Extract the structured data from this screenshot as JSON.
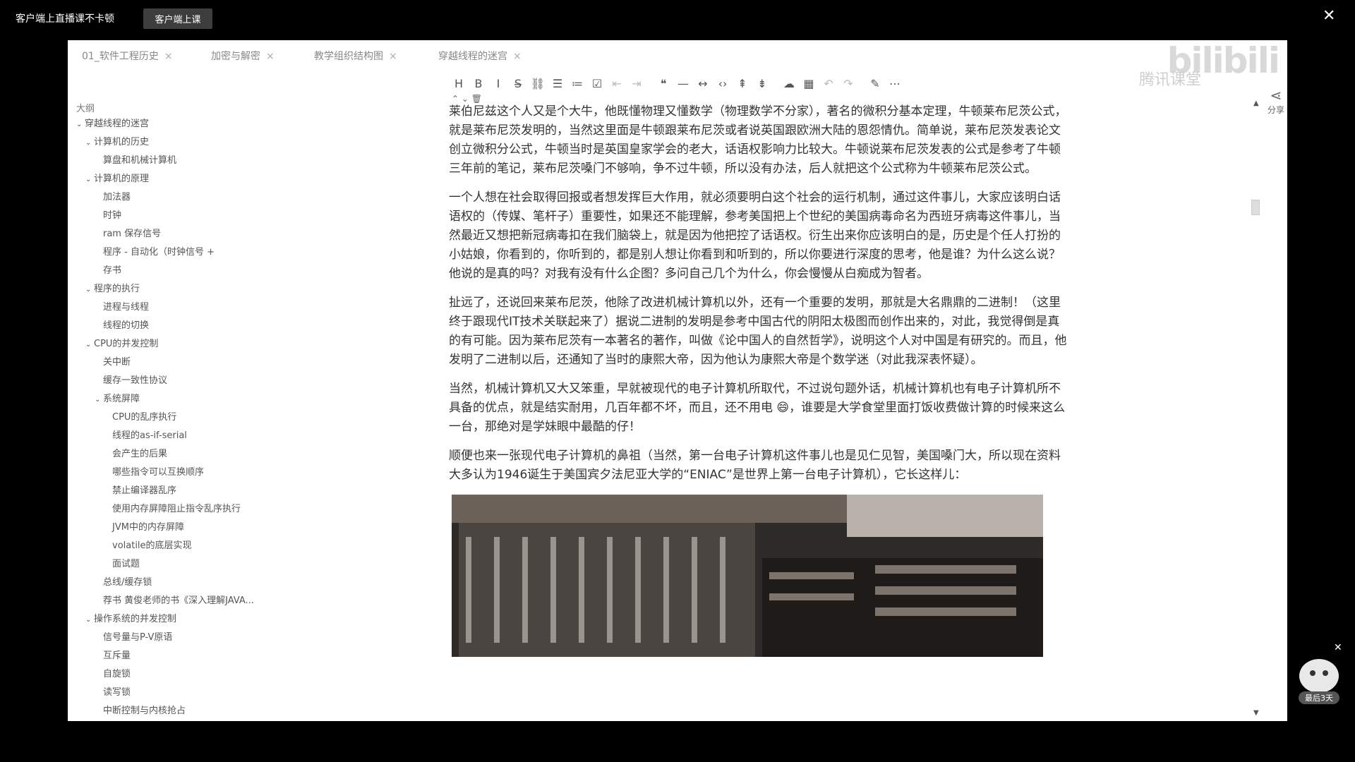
{
  "topbar": {
    "promo_text": "客户端上直播课不卡顿",
    "promo_button": "客户端上课",
    "close_label": "✕"
  },
  "tabs": [
    {
      "label": "01_软件工程历史"
    },
    {
      "label": "加密与解密"
    },
    {
      "label": "教学组织结构图"
    },
    {
      "label": "穿越线程的迷宫"
    }
  ],
  "watermark": {
    "site_logo": "bilibili",
    "tencent": "腾讯课堂"
  },
  "sidebar": {
    "title": "大纲",
    "items": [
      {
        "label": "穿越线程的迷宫",
        "level": 0,
        "expanded": true
      },
      {
        "label": "计算机的历史",
        "level": 1,
        "expanded": true
      },
      {
        "label": "算盘和机械计算机",
        "level": 2
      },
      {
        "label": "计算机的原理",
        "level": 1,
        "expanded": true
      },
      {
        "label": "加法器",
        "level": 2
      },
      {
        "label": "时钟",
        "level": 2
      },
      {
        "label": "ram 保存信号",
        "level": 2
      },
      {
        "label": "程序 - 自动化（时钟信号 +",
        "level": 2
      },
      {
        "label": "存书",
        "level": 2
      },
      {
        "label": "程序的执行",
        "level": 1,
        "expanded": true
      },
      {
        "label": "进程与线程",
        "level": 2
      },
      {
        "label": "线程的切换",
        "level": 2
      },
      {
        "label": "CPU的并发控制",
        "level": 1,
        "expanded": true
      },
      {
        "label": "关中断",
        "level": 2
      },
      {
        "label": "缓存一致性协议",
        "level": 2
      },
      {
        "label": "系统屏障",
        "level": 2,
        "expanded": true
      },
      {
        "label": "CPU的乱序执行",
        "level": 3
      },
      {
        "label": "线程的as-if-serial",
        "level": 3
      },
      {
        "label": "会产生的后果",
        "level": 3
      },
      {
        "label": "哪些指令可以互换顺序",
        "level": 3
      },
      {
        "label": "禁止编译器乱序",
        "level": 3
      },
      {
        "label": "使用内存屏障阻止指令乱序执行",
        "level": 3
      },
      {
        "label": "JVM中的内存屏障",
        "level": 3
      },
      {
        "label": "volatile的底层实现",
        "level": 3
      },
      {
        "label": "面试题",
        "level": 3
      },
      {
        "label": "总线/缓存锁",
        "level": 2
      },
      {
        "label": "荐书 黄俊老师的书《深入理解JAVA...",
        "level": 2
      },
      {
        "label": "操作系统的并发控制",
        "level": 1,
        "expanded": true
      },
      {
        "label": "信号量与P-V原语",
        "level": 2
      },
      {
        "label": "互斥量",
        "level": 2
      },
      {
        "label": "自旋锁",
        "level": 2
      },
      {
        "label": "读写锁",
        "level": 2
      },
      {
        "label": "中断控制与内核抢占",
        "level": 2
      }
    ]
  },
  "toolbar": {
    "items": [
      {
        "icon": "heading-icon",
        "glyph": "H"
      },
      {
        "icon": "bold-icon",
        "glyph": "B"
      },
      {
        "icon": "italic-icon",
        "glyph": "I"
      },
      {
        "icon": "strikethrough-icon",
        "glyph": "S̶"
      },
      {
        "icon": "link-icon",
        "glyph": "⛓"
      },
      {
        "icon": "bullet-list-icon",
        "glyph": "☰"
      },
      {
        "icon": "ordered-list-icon",
        "glyph": "≔"
      },
      {
        "icon": "checklist-icon",
        "glyph": "☑"
      },
      {
        "icon": "outdent-icon",
        "glyph": "⇤",
        "dim": true
      },
      {
        "icon": "indent-icon",
        "glyph": "⇥",
        "dim": true
      },
      {
        "icon": "quote-icon",
        "glyph": "❝"
      },
      {
        "icon": "horizontal-rule-icon",
        "glyph": "—"
      },
      {
        "icon": "inline-code-icon",
        "glyph": "↔"
      },
      {
        "icon": "code-block-icon",
        "glyph": "‹›"
      },
      {
        "icon": "insert-before-icon",
        "glyph": "⇞"
      },
      {
        "icon": "insert-after-icon",
        "glyph": "⇟"
      },
      {
        "icon": "upload-icon",
        "glyph": "☁"
      },
      {
        "icon": "table-icon",
        "glyph": "▦"
      },
      {
        "icon": "undo-icon",
        "glyph": "↶",
        "dim": true
      },
      {
        "icon": "redo-icon",
        "glyph": "↷",
        "dim": true
      },
      {
        "icon": "edit-icon",
        "glyph": "✎"
      },
      {
        "icon": "more-icon",
        "glyph": "⋯"
      }
    ],
    "sub": "⌃ ⌄ 🗑"
  },
  "content": {
    "paragraphs": [
      "莱伯尼兹这个人又是个大牛，他既懂物理又懂数学（物理数学不分家），著名的微积分基本定理，牛顿莱布尼茨公式，就是莱布尼茨发明的，当然这里面是牛顿跟莱布尼茨或者说英国跟欧洲大陆的恩怨情仇。简单说，莱布尼茨发表论文创立微积分公式，牛顿当时是英国皇家学会的老大，话语权影响力比较大。牛顿说莱布尼茨发表的公式是参考了牛顿三年前的笔记，莱布尼茨嗓门不够响，争不过牛顿，所以没有办法，后人就把这个公式称为牛顿莱布尼茨公式。",
      "一个人想在社会取得回报或者想发挥巨大作用，就必须要明白这个社会的运行机制，通过这件事儿，大家应该明白话语权的（传媒、笔杆子）重要性，如果还不能理解，参考美国把上个世纪的美国病毒命名为西班牙病毒这件事儿，当然最近又想把新冠病毒扣在我们脑袋上，就是因为他把控了话语权。衍生出来你应该明白的是，历史是个任人打扮的小姑娘，你看到的，你听到的，都是别人想让你看到和听到的，所以你要进行深度的思考，他是谁？为什么这么说？他说的是真的吗？对我有没有什么企图？多问自己几个为什么，你会慢慢从白痴成为智者。",
      "扯远了，还说回来莱布尼茨，他除了改进机械计算机以外，还有一个重要的发明，那就是大名鼎鼎的二进制！（这里终于跟现代IT技术关联起来了）据说二进制的发明是参考中国古代的阴阳太极图而创作出来的，对此，我觉得倒是真的有可能。因为莱布尼茨有一本著名的著作，叫做《论中国人的自然哲学》，说明这个人对中国是有研究的。而且，他发明了二进制以后，还通知了当时的康熙大帝，因为他认为康熙大帝是个数学迷（对此我深表怀疑）。",
      "当然，机械计算机又大又笨重，早就被现代的电子计算机所取代，不过说句题外话，机械计算机也有电子计算机所不具备的优点，就是结实耐用，几百年都不坏，而且，还不用电 😄，谁要是大学食堂里面打饭收费做计算的时候来这么一台，那绝对是学妹眼中最酷的仔！",
      "顺便也来一张现代电子计算机的鼻祖（当然，第一台电子计算机这件事儿也是见仁见智，美国嗓门大，所以现在资料大多认为1946诞生于美国宾夕法尼亚大学的“ENIAC”是世界上第一台电子计算机），它长这样儿："
    ]
  },
  "right": {
    "share_label": "分享"
  },
  "mascot": {
    "badge": "最后3天"
  }
}
